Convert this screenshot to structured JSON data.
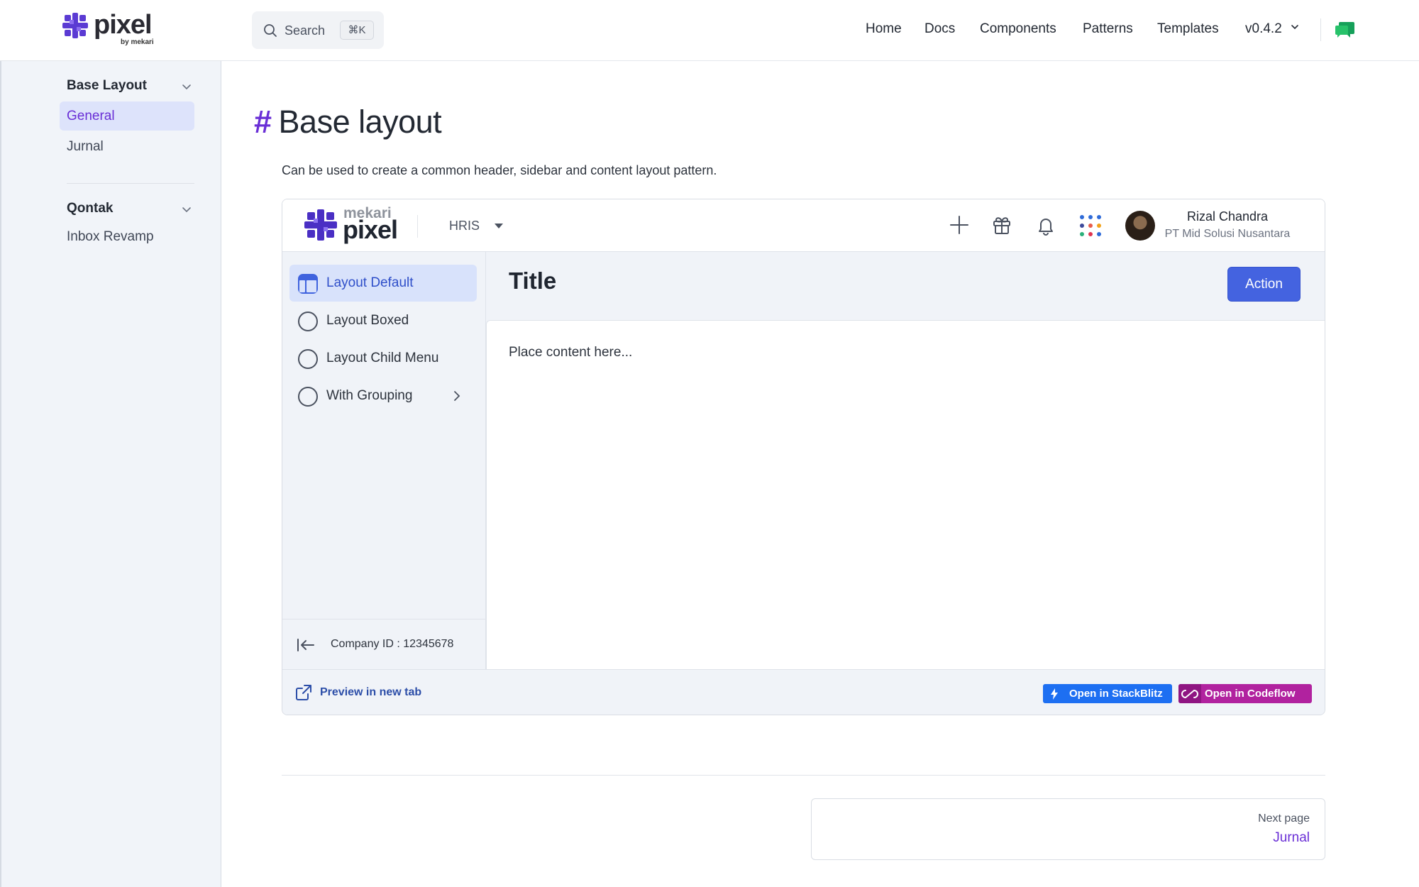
{
  "brand": {
    "name": "pixel",
    "by": "by mekari"
  },
  "search": {
    "label": "Search",
    "shortcut": "⌘K"
  },
  "nav": {
    "items": [
      "Home",
      "Docs",
      "Components",
      "Patterns",
      "Templates"
    ],
    "version": "v0.4.2"
  },
  "sidebar": {
    "groups": [
      {
        "title": "Base Layout",
        "items": [
          "General",
          "Jurnal"
        ],
        "active": "General"
      },
      {
        "title": "Qontak",
        "items": [
          "Inbox Revamp"
        ]
      }
    ]
  },
  "page": {
    "title": "Base layout",
    "hash": "#",
    "description": "Can be used to create a common header, sidebar and content layout pattern."
  },
  "preview": {
    "logo": {
      "top": "mekari",
      "bottom": "pixel"
    },
    "product": "HRIS",
    "user": {
      "name": "Rizal Chandra",
      "company": "PT Mid Solusi Nusantara"
    },
    "menu": [
      {
        "label": "Layout Default",
        "icon": "layout-icon",
        "active": true
      },
      {
        "label": "Layout Boxed",
        "icon": "circle-icon"
      },
      {
        "label": "Layout Child Menu",
        "icon": "circle-icon"
      },
      {
        "label": "With Grouping",
        "icon": "circle-icon",
        "has_children": true
      }
    ],
    "company_id": "Company ID : 12345678",
    "title": "Title",
    "action": "Action",
    "content": "Place content here...",
    "preview_link": "Preview in new tab",
    "stackblitz": "Open in StackBlitz",
    "codeflow": "Open in Codeflow"
  },
  "pager": {
    "label": "Next page",
    "link": "Jurnal"
  },
  "colors": {
    "accent": "#6a2fd6",
    "primary": "#4463e0",
    "stackblitz": "#1d6ff2",
    "codeflow": "#b1229f"
  }
}
